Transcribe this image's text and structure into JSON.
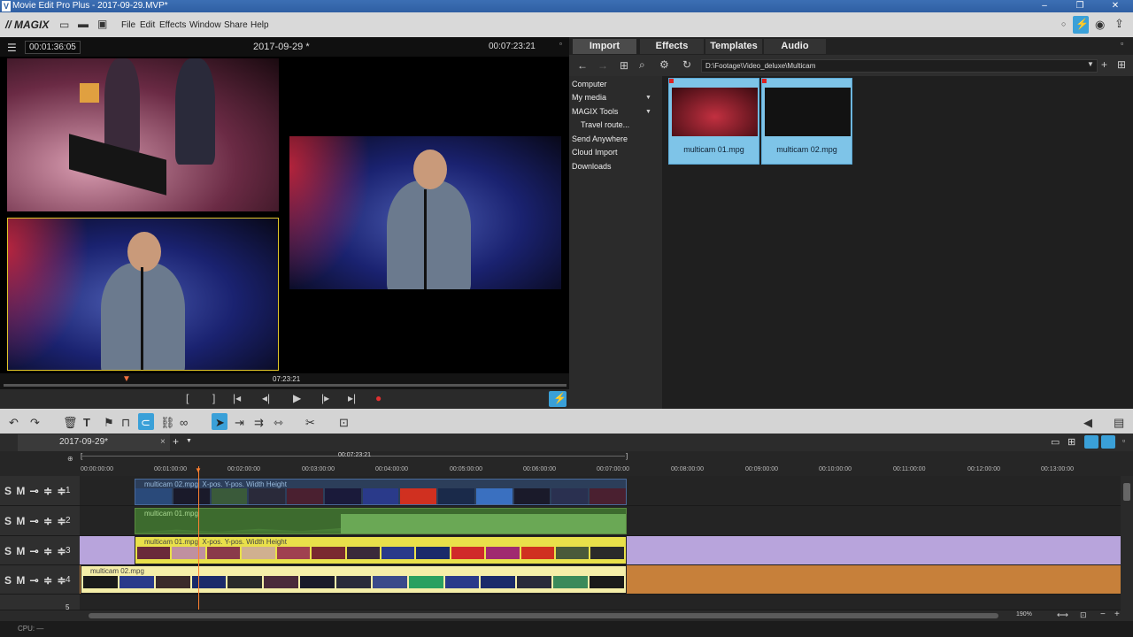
{
  "window": {
    "title": "Movie Edit Pro Plus - 2017-09-29.MVP*",
    "minimize": "–",
    "maximize": "❐",
    "close": "✕"
  },
  "app": {
    "logo": "MAGIX"
  },
  "menu": {
    "items": [
      "File",
      "Edit",
      "Effects",
      "Window",
      "Share",
      "Help"
    ]
  },
  "preview": {
    "current_tc": "00:01:36:05",
    "title": "2017-09-29 *",
    "total_tc": "00:07:23:21",
    "scrub_tc": "07:23:21"
  },
  "transport": {
    "mark_in": "[",
    "mark_out": "]",
    "prev_marker": "|◂",
    "step_back": "◂|",
    "play": "▶",
    "step_fwd": "|▸",
    "next_marker": "▸|",
    "record": "●"
  },
  "media_tabs": [
    "Import",
    "Effects",
    "Templates",
    "Audio"
  ],
  "media": {
    "path": "D:\\Footage\\Video_deluxe\\Multicam",
    "tree": [
      "Computer",
      "My media",
      "MAGIX Tools",
      "Travel route...",
      "Send Anywhere",
      "Cloud Import",
      "Downloads"
    ],
    "files": [
      {
        "name": "multicam 01.mpg"
      },
      {
        "name": "multicam 02.mpg"
      }
    ]
  },
  "timeline": {
    "project_tab": "2017-09-29*",
    "range_tc": "00:07:23:21",
    "ruler": [
      "00:00:00:00",
      "00:01:00:00",
      "00:02:00:00",
      "00:03:00:00",
      "00:04:00:00",
      "00:05:00:00",
      "00:06:00:00",
      "00:07:00:00",
      "00:08:00:00",
      "00:09:00:00",
      "00:10:00:00",
      "00:11:00:00",
      "00:12:00:00",
      "00:13:00:00"
    ],
    "track_controls": "S M",
    "tracks": [
      {
        "num": "1",
        "clip": "multicam 02.mpg",
        "extra": "X-pos.  Y-pos.  Width  Height"
      },
      {
        "num": "2",
        "clip": "multicam 01.mpg",
        "extra": ""
      },
      {
        "num": "3",
        "clip": "multicam 01.mpg",
        "extra": "X-pos.  Y-pos.  Width  Height"
      },
      {
        "num": "4",
        "clip": "multicam 02.mpg",
        "extra": ""
      },
      {
        "num": "5",
        "clip": "",
        "extra": ""
      }
    ],
    "zoom": "190%"
  },
  "status": {
    "cpu": "CPU: —"
  }
}
